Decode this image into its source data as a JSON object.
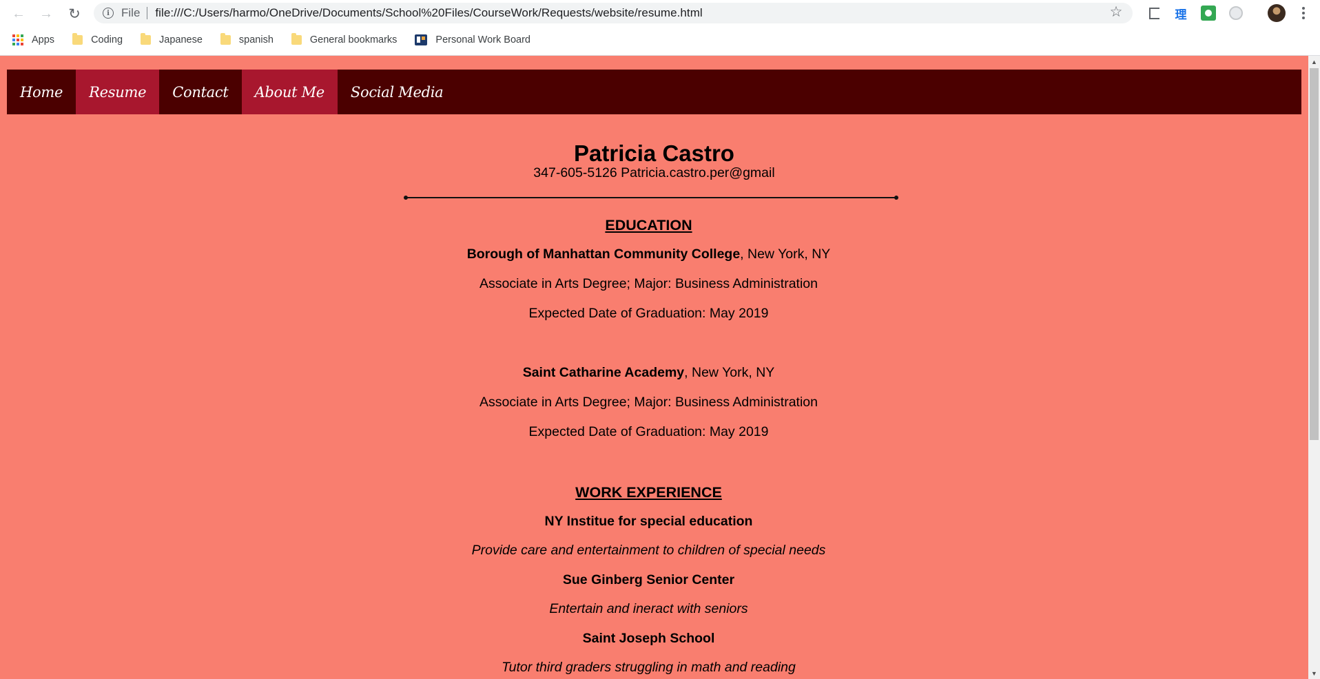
{
  "browser": {
    "scheme_label": "File",
    "url": "file:///C:/Users/harmo/OneDrive/Documents/School%20Files/CourseWork/Requests/website/resume.html",
    "back_icon": "back-arrow-icon",
    "forward_icon": "forward-arrow-icon",
    "reload_icon": "reload-icon",
    "extension_2_glyph": "理"
  },
  "bookmarks": [
    {
      "label": "Apps",
      "icon": "apps-grid-icon"
    },
    {
      "label": "Coding",
      "icon": "folder-icon"
    },
    {
      "label": "Japanese",
      "icon": "folder-icon"
    },
    {
      "label": "spanish",
      "icon": "folder-icon"
    },
    {
      "label": "General bookmarks",
      "icon": "folder-icon"
    },
    {
      "label": "Personal Work Board",
      "icon": "board-icon"
    }
  ],
  "site_nav": [
    {
      "label": "Home",
      "active": false
    },
    {
      "label": "Resume",
      "active": true
    },
    {
      "label": "Contact",
      "active": false
    },
    {
      "label": "About Me",
      "active": true
    },
    {
      "label": "Social Media",
      "active": false
    }
  ],
  "resume": {
    "name": "Patricia Castro",
    "contact": "347-605-5126 Patricia.castro.per@gmail",
    "education_heading": "EDUCATION",
    "education": [
      {
        "school": "Borough of Manhattan Community College",
        "location": ", New York, NY",
        "degree": "Associate in Arts Degree; Major: Business Administration",
        "graduation": "Expected Date of Graduation: May 2019"
      },
      {
        "school": "Saint Catharine Academy",
        "location": ", New York, NY",
        "degree": "Associate in Arts Degree; Major: Business Administration",
        "graduation": "Expected Date of Graduation: May 2019"
      }
    ],
    "work_heading": "WORK EXPERIENCE",
    "work": [
      {
        "employer": "NY Institue for special education",
        "description": "Provide care and entertainment to children of special needs"
      },
      {
        "employer": "Sue Ginberg Senior Center",
        "description": "Entertain and ineract with seniors"
      },
      {
        "employer": "Saint Joseph School",
        "description": "Tutor third graders struggling in math and reading"
      }
    ]
  },
  "colors": {
    "page_background": "#f97e6f",
    "nav_background": "#4b0000",
    "nav_active": "#a8172e"
  }
}
